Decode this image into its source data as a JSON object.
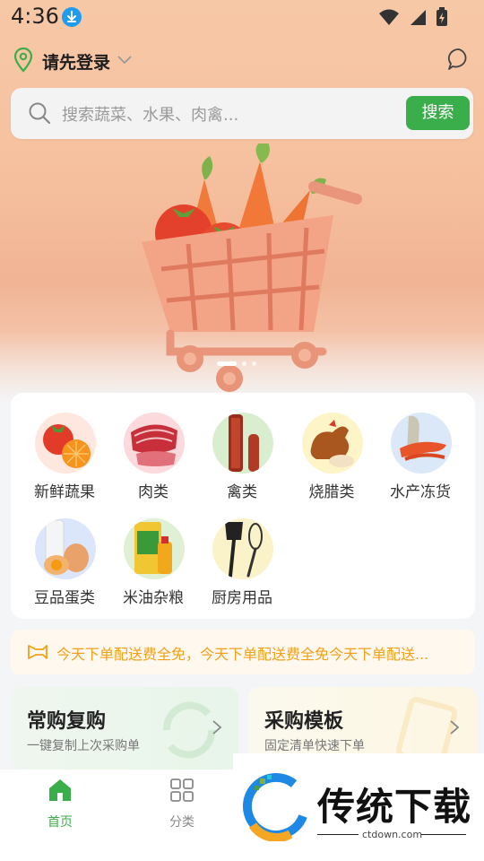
{
  "status_bar": {
    "time": "4:36"
  },
  "location": {
    "label": "请先登录"
  },
  "search": {
    "placeholder": "搜索蔬菜、水果、肉禽...",
    "button_label": "搜索"
  },
  "categories": [
    {
      "label": "新鲜蔬果",
      "icon": "vegetables-fruit-icon"
    },
    {
      "label": "肉类",
      "icon": "meat-icon"
    },
    {
      "label": "禽类",
      "icon": "poultry-icon"
    },
    {
      "label": "烧腊类",
      "icon": "roast-meat-icon"
    },
    {
      "label": "水产冻货",
      "icon": "seafood-icon"
    },
    {
      "label": "豆品蛋类",
      "icon": "tofu-egg-icon"
    },
    {
      "label": "米油杂粮",
      "icon": "rice-oil-icon"
    },
    {
      "label": "厨房用品",
      "icon": "kitchenware-icon"
    }
  ],
  "notice": {
    "text": "今天下单配送费全免，今天下单配送费全免今天下单配送..."
  },
  "quick_cards": [
    {
      "title": "常购复购",
      "subtitle": "一键复制上次采购单"
    },
    {
      "title": "采购模板",
      "subtitle": "固定清单快速下单"
    }
  ],
  "tabs": [
    {
      "label": "首页",
      "active": true
    },
    {
      "label": "分类",
      "active": false
    }
  ],
  "watermark": {
    "title": "传统下载",
    "url": "ctdown.com"
  },
  "colors": {
    "accent": "#3aae4a",
    "notice": "#f0a019",
    "hero": "#f6c19f"
  }
}
